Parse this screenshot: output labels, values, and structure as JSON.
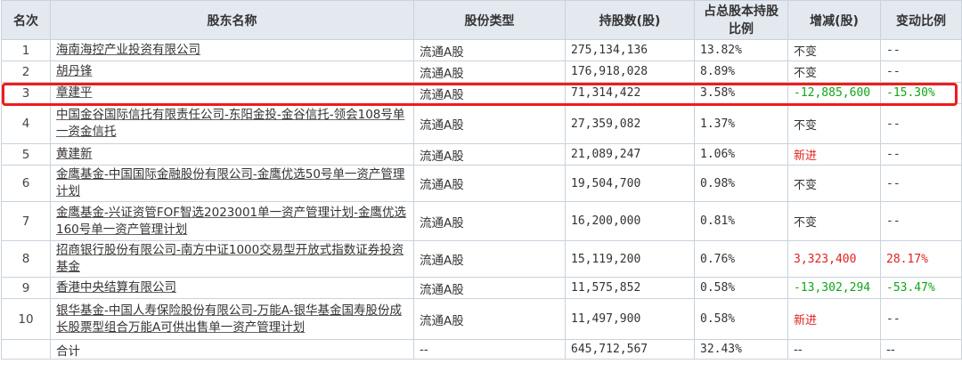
{
  "headers": {
    "rank": "名次",
    "name": "股东名称",
    "share_type": "股份类型",
    "shares": "持股数(股)",
    "ratio": "占总股本持股比例",
    "change": "增减(股)",
    "change_ratio": "变动比例"
  },
  "rows": [
    {
      "rank": "1",
      "name": "海南海控产业投资有限公司",
      "share_type": "流通A股",
      "shares": "275,134,136",
      "ratio": "13.82%",
      "change": "不变",
      "change_ratio": "--"
    },
    {
      "rank": "2",
      "name": "胡丹锋",
      "share_type": "流通A股",
      "shares": "176,918,028",
      "ratio": "8.89%",
      "change": "不变",
      "change_ratio": "--"
    },
    {
      "rank": "3",
      "name": "章建平",
      "share_type": "流通A股",
      "shares": "71,314,422",
      "ratio": "3.58%",
      "change": "-12,885,600",
      "change_ratio": "-15.30%"
    },
    {
      "rank": "4",
      "name": "中国金谷国际信托有限责任公司-东阳金投-金谷信托-领会108号单一资金信托",
      "share_type": "流通A股",
      "shares": "27,359,082",
      "ratio": "1.37%",
      "change": "不变",
      "change_ratio": "--"
    },
    {
      "rank": "5",
      "name": "黄建新",
      "share_type": "流通A股",
      "shares": "21,089,247",
      "ratio": "1.06%",
      "change": "新进",
      "change_ratio": "--"
    },
    {
      "rank": "6",
      "name": "金鹰基金-中国国际金融股份有限公司-金鹰优选50号单一资产管理计划",
      "share_type": "流通A股",
      "shares": "19,504,700",
      "ratio": "0.98%",
      "change": "不变",
      "change_ratio": "--"
    },
    {
      "rank": "7",
      "name": "金鹰基金-兴证资管FOF智选2023001单一资产管理计划-金鹰优选160号单一资产管理计划",
      "share_type": "流通A股",
      "shares": "16,200,000",
      "ratio": "0.81%",
      "change": "不变",
      "change_ratio": "--"
    },
    {
      "rank": "8",
      "name": "招商银行股份有限公司-南方中证1000交易型开放式指数证券投资基金",
      "share_type": "流通A股",
      "shares": "15,119,200",
      "ratio": "0.76%",
      "change": "3,323,400",
      "change_ratio": "28.17%"
    },
    {
      "rank": "9",
      "name": "香港中央结算有限公司",
      "share_type": "流通A股",
      "shares": "11,575,852",
      "ratio": "0.58%",
      "change": "-13,302,294",
      "change_ratio": "-53.47%"
    },
    {
      "rank": "10",
      "name": "银华基金-中国人寿保险股份有限公司-万能A-银华基金国寿股份成长股票型组合万能A可供出售单一资产管理计划",
      "share_type": "流通A股",
      "shares": "11,497,900",
      "ratio": "0.58%",
      "change": "新进",
      "change_ratio": "--"
    }
  ],
  "total": {
    "label": "合计",
    "share_type": "--",
    "shares": "645,712,567",
    "ratio": "32.43%",
    "change": "--",
    "change_ratio": "--"
  },
  "colors": {
    "header_bg": "#e4e9f0",
    "border": "#c9d2dd",
    "increase": "#e02222",
    "decrease": "#11a51a",
    "highlight_box": "#ee1c1c"
  },
  "highlighted_rank": "3"
}
